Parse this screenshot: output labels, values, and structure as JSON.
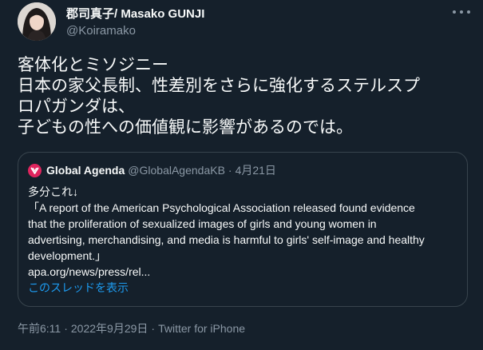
{
  "author": {
    "display_name": "郡司真子/ Masako GUNJI",
    "handle": "@Koiramako"
  },
  "tweet": {
    "lines": [
      "客体化とミソジニー",
      "日本の家父長制、性差別をさらに強化するステルスプ",
      "ロパガンダは、",
      "子どもの性への価値観に影響があるのでは。"
    ]
  },
  "quote": {
    "name": "Global Agenda",
    "handle": "@GlobalAgendaKB",
    "separator": "·",
    "date": "4月21日",
    "lines": [
      "多分これ↓",
      "「A report of the American Psychological Association released found evidence",
      "that the proliferation of sexualized images of girls and young women in",
      "advertising, merchandising, and media is harmful to girls' self-image and healthy",
      "development.」",
      "apa.org/news/press/rel..."
    ],
    "thread_link": "このスレッドを表示",
    "logo_color": "#e0245e"
  },
  "meta": {
    "time": "午前6:11",
    "separator": "·",
    "date": "2022年9月29日",
    "source": "Twitter for iPhone"
  },
  "colors": {
    "background": "#15202b",
    "text": "#f7f9f9",
    "muted": "#8b98a5",
    "link": "#1d9bf0",
    "border": "#38444d"
  }
}
